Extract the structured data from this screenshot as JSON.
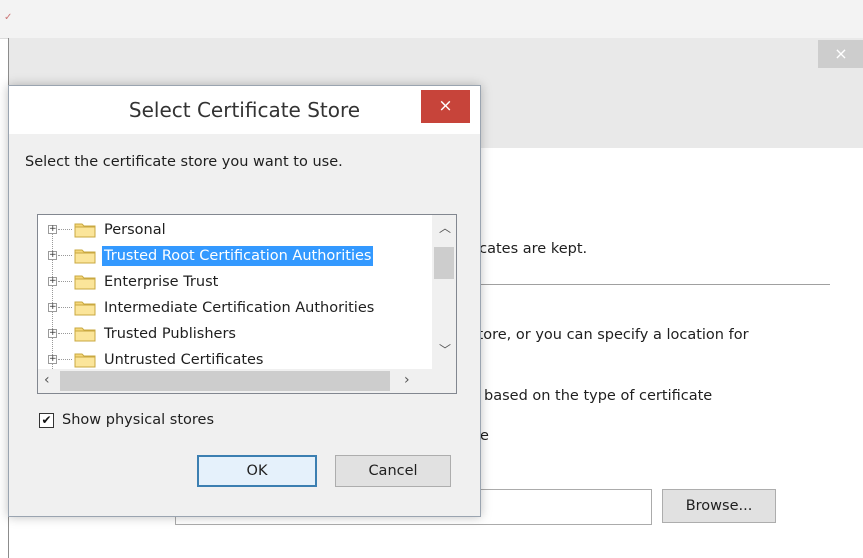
{
  "background": {
    "close_glyph": "×",
    "lines": [
      "ficates are kept.",
      "store, or you can specify a location for",
      "based on the type of certificate",
      "e"
    ],
    "browse_label": "Browse..."
  },
  "dialog": {
    "title": "Select Certificate Store",
    "close_glyph": "×",
    "prompt": "Select the certificate store you want to use.",
    "stores": [
      {
        "label": "Personal",
        "selected": false
      },
      {
        "label": "Trusted Root Certification Authorities",
        "selected": true
      },
      {
        "label": "Enterprise Trust",
        "selected": false
      },
      {
        "label": "Intermediate Certification Authorities",
        "selected": false
      },
      {
        "label": "Trusted Publishers",
        "selected": false
      },
      {
        "label": "Untrusted Certificates",
        "selected": false
      }
    ],
    "show_physical_stores": {
      "label": "Show physical stores",
      "checked": true
    },
    "ok_label": "OK",
    "cancel_label": "Cancel"
  },
  "colors": {
    "selection": "#3399ff",
    "close_button": "#c7443a",
    "ok_border": "#3c7fb1"
  },
  "icons": {
    "tree_expander": "plus-box-icon",
    "store": "folder-icon",
    "check": "checkmark-icon"
  }
}
